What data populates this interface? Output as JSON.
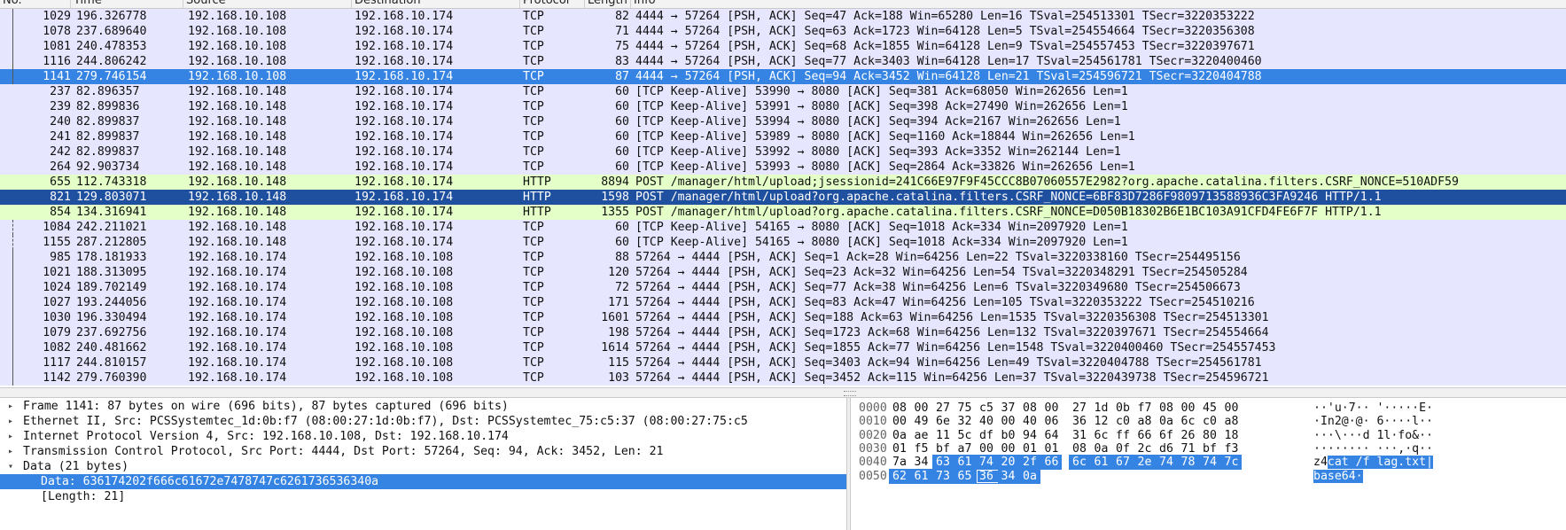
{
  "columns": [
    "No.",
    "Time",
    "Source",
    "Destination",
    "Protocol",
    "Length",
    "Info"
  ],
  "packets": [
    {
      "no": "1029",
      "time": "196.326778",
      "src": "192.168.10.108",
      "dst": "192.168.10.174",
      "proto": "TCP",
      "len": "82",
      "info": "4444 → 57264 [PSH, ACK] Seq=47 Ack=188 Win=65280 Len=16 TSval=254513301 TSecr=3220353222",
      "style": "tcp"
    },
    {
      "no": "1078",
      "time": "237.689640",
      "src": "192.168.10.108",
      "dst": "192.168.10.174",
      "proto": "TCP",
      "len": "71",
      "info": "4444 → 57264 [PSH, ACK] Seq=63 Ack=1723 Win=64128 Len=5 TSval=254554664 TSecr=3220356308",
      "style": "tcp"
    },
    {
      "no": "1081",
      "time": "240.478353",
      "src": "192.168.10.108",
      "dst": "192.168.10.174",
      "proto": "TCP",
      "len": "75",
      "info": "4444 → 57264 [PSH, ACK] Seq=68 Ack=1855 Win=64128 Len=9 TSval=254557453 TSecr=3220397671",
      "style": "tcp"
    },
    {
      "no": "1116",
      "time": "244.806242",
      "src": "192.168.10.108",
      "dst": "192.168.10.174",
      "proto": "TCP",
      "len": "83",
      "info": "4444 → 57264 [PSH, ACK] Seq=77 Ack=3403 Win=64128 Len=17 TSval=254561781 TSecr=3220400460",
      "style": "tcp"
    },
    {
      "no": "1141",
      "time": "279.746154",
      "src": "192.168.10.108",
      "dst": "192.168.10.174",
      "proto": "TCP",
      "len": "87",
      "info": "4444 → 57264 [PSH, ACK] Seq=94 Ack=3452 Win=64128 Len=21 TSval=254596721 TSecr=3220404788",
      "style": "sel"
    },
    {
      "no": "237",
      "time": "82.896357",
      "src": "192.168.10.148",
      "dst": "192.168.10.174",
      "proto": "TCP",
      "len": "60",
      "info": "[TCP Keep-Alive] 53990 → 8080 [ACK] Seq=381 Ack=68050 Win=262656 Len=1",
      "style": "tcp"
    },
    {
      "no": "239",
      "time": "82.899836",
      "src": "192.168.10.148",
      "dst": "192.168.10.174",
      "proto": "TCP",
      "len": "60",
      "info": "[TCP Keep-Alive] 53991 → 8080 [ACK] Seq=398 Ack=27490 Win=262656 Len=1",
      "style": "tcp"
    },
    {
      "no": "240",
      "time": "82.899837",
      "src": "192.168.10.148",
      "dst": "192.168.10.174",
      "proto": "TCP",
      "len": "60",
      "info": "[TCP Keep-Alive] 53994 → 8080 [ACK] Seq=394 Ack=2167 Win=262656 Len=1",
      "style": "tcp"
    },
    {
      "no": "241",
      "time": "82.899837",
      "src": "192.168.10.148",
      "dst": "192.168.10.174",
      "proto": "TCP",
      "len": "60",
      "info": "[TCP Keep-Alive] 53989 → 8080 [ACK] Seq=1160 Ack=18844 Win=262656 Len=1",
      "style": "tcp"
    },
    {
      "no": "242",
      "time": "82.899837",
      "src": "192.168.10.148",
      "dst": "192.168.10.174",
      "proto": "TCP",
      "len": "60",
      "info": "[TCP Keep-Alive] 53992 → 8080 [ACK] Seq=393 Ack=3352 Win=262144 Len=1",
      "style": "tcp"
    },
    {
      "no": "264",
      "time": "92.903734",
      "src": "192.168.10.148",
      "dst": "192.168.10.174",
      "proto": "TCP",
      "len": "60",
      "info": "[TCP Keep-Alive] 53993 → 8080 [ACK] Seq=2864 Ack=33826 Win=262656 Len=1",
      "style": "tcp"
    },
    {
      "no": "655",
      "time": "112.743318",
      "src": "192.168.10.148",
      "dst": "192.168.10.174",
      "proto": "HTTP",
      "len": "8894",
      "info": "POST /manager/html/upload;jsessionid=241C66E97F9F45CCC8B07060557E2982?org.apache.catalina.filters.CSRF_NONCE=510ADF59",
      "style": "http"
    },
    {
      "no": "821",
      "time": "129.803071",
      "src": "192.168.10.148",
      "dst": "192.168.10.174",
      "proto": "HTTP",
      "len": "1598",
      "info": "POST /manager/html/upload?org.apache.catalina.filters.CSRF_NONCE=6BF83D7286F9809713588936C3FA9246 HTTP/1.1",
      "style": "sel2"
    },
    {
      "no": "854",
      "time": "134.316941",
      "src": "192.168.10.148",
      "dst": "192.168.10.174",
      "proto": "HTTP",
      "len": "1355",
      "info": "POST /manager/html/upload?org.apache.catalina.filters.CSRF_NONCE=D050B18302B6E1BC103A91CFD4FE6F7F HTTP/1.1",
      "style": "http"
    },
    {
      "no": "1084",
      "time": "242.211021",
      "src": "192.168.10.148",
      "dst": "192.168.10.174",
      "proto": "TCP",
      "len": "60",
      "info": "[TCP Keep-Alive] 54165 → 8080 [ACK] Seq=1018 Ack=334 Win=2097920 Len=1",
      "style": "tcp"
    },
    {
      "no": "1155",
      "time": "287.212805",
      "src": "192.168.10.148",
      "dst": "192.168.10.174",
      "proto": "TCP",
      "len": "60",
      "info": "[TCP Keep-Alive] 54165 → 8080 [ACK] Seq=1018 Ack=334 Win=2097920 Len=1",
      "style": "tcp"
    },
    {
      "no": "985",
      "time": "178.181933",
      "src": "192.168.10.174",
      "dst": "192.168.10.108",
      "proto": "TCP",
      "len": "88",
      "info": "57264 → 4444 [PSH, ACK] Seq=1 Ack=28 Win=64256 Len=22 TSval=3220338160 TSecr=254495156",
      "style": "tcp"
    },
    {
      "no": "1021",
      "time": "188.313095",
      "src": "192.168.10.174",
      "dst": "192.168.10.108",
      "proto": "TCP",
      "len": "120",
      "info": "57264 → 4444 [PSH, ACK] Seq=23 Ack=32 Win=64256 Len=54 TSval=3220348291 TSecr=254505284",
      "style": "tcp"
    },
    {
      "no": "1024",
      "time": "189.702149",
      "src": "192.168.10.174",
      "dst": "192.168.10.108",
      "proto": "TCP",
      "len": "72",
      "info": "57264 → 4444 [PSH, ACK] Seq=77 Ack=38 Win=64256 Len=6 TSval=3220349680 TSecr=254506673",
      "style": "tcp"
    },
    {
      "no": "1027",
      "time": "193.244056",
      "src": "192.168.10.174",
      "dst": "192.168.10.108",
      "proto": "TCP",
      "len": "171",
      "info": "57264 → 4444 [PSH, ACK] Seq=83 Ack=47 Win=64256 Len=105 TSval=3220353222 TSecr=254510216",
      "style": "tcp"
    },
    {
      "no": "1030",
      "time": "196.330494",
      "src": "192.168.10.174",
      "dst": "192.168.10.108",
      "proto": "TCP",
      "len": "1601",
      "info": "57264 → 4444 [PSH, ACK] Seq=188 Ack=63 Win=64256 Len=1535 TSval=3220356308 TSecr=254513301",
      "style": "tcp"
    },
    {
      "no": "1079",
      "time": "237.692756",
      "src": "192.168.10.174",
      "dst": "192.168.10.108",
      "proto": "TCP",
      "len": "198",
      "info": "57264 → 4444 [PSH, ACK] Seq=1723 Ack=68 Win=64256 Len=132 TSval=3220397671 TSecr=254554664",
      "style": "tcp"
    },
    {
      "no": "1082",
      "time": "240.481662",
      "src": "192.168.10.174",
      "dst": "192.168.10.108",
      "proto": "TCP",
      "len": "1614",
      "info": "57264 → 4444 [PSH, ACK] Seq=1855 Ack=77 Win=64256 Len=1548 TSval=3220400460 TSecr=254557453",
      "style": "tcp"
    },
    {
      "no": "1117",
      "time": "244.810157",
      "src": "192.168.10.174",
      "dst": "192.168.10.108",
      "proto": "TCP",
      "len": "115",
      "info": "57264 → 4444 [PSH, ACK] Seq=3403 Ack=94 Win=64256 Len=49 TSval=3220404788 TSecr=254561781",
      "style": "tcp"
    },
    {
      "no": "1142",
      "time": "279.760390",
      "src": "192.168.10.174",
      "dst": "192.168.10.108",
      "proto": "TCP",
      "len": "103",
      "info": "57264 → 4444 [PSH, ACK] Seq=3452 Ack=115 Win=64256 Len=37 TSval=3220439738 TSecr=254596721",
      "style": "tcp"
    }
  ],
  "details": [
    {
      "text": "Frame 1141: 87 bytes on wire (696 bits), 87 bytes captured (696 bits)",
      "arrow": "▸"
    },
    {
      "text": "Ethernet II, Src: PCSSystemtec_1d:0b:f7 (08:00:27:1d:0b:f7), Dst: PCSSystemtec_75:c5:37 (08:00:27:75:c5",
      "arrow": "▸"
    },
    {
      "text": "Internet Protocol Version 4, Src: 192.168.10.108, Dst: 192.168.10.174",
      "arrow": "▸"
    },
    {
      "text": "Transmission Control Protocol, Src Port: 4444, Dst Port: 57264, Seq: 94, Ack: 3452, Len: 21",
      "arrow": "▸"
    },
    {
      "text": "Data (21 bytes)",
      "arrow": "▾"
    },
    {
      "text": "Data: 636174202f666c61672e7478747c6261736536340a",
      "arrow": "",
      "child": true,
      "selected": true
    },
    {
      "text": "[Length: 21]",
      "arrow": "",
      "child": true
    }
  ],
  "hex": [
    {
      "offset": "0000",
      "bytes": [
        "08",
        "00",
        "27",
        "75",
        "c5",
        "37",
        "08",
        "00",
        "27",
        "1d",
        "0b",
        "f7",
        "08",
        "00",
        "45",
        "00"
      ],
      "ascii": "··'u·7·· '·····E·",
      "hl_from": -1
    },
    {
      "offset": "0010",
      "bytes": [
        "00",
        "49",
        "6e",
        "32",
        "40",
        "00",
        "40",
        "06",
        "36",
        "12",
        "c0",
        "a8",
        "0a",
        "6c",
        "c0",
        "a8"
      ],
      "ascii": "·In2@·@· 6····l··",
      "hl_from": -1
    },
    {
      "offset": "0020",
      "bytes": [
        "0a",
        "ae",
        "11",
        "5c",
        "df",
        "b0",
        "94",
        "64",
        "31",
        "6c",
        "ff",
        "66",
        "6f",
        "26",
        "80",
        "18"
      ],
      "ascii": "···\\···d 1l·fo&··",
      "hl_from": -1
    },
    {
      "offset": "0030",
      "bytes": [
        "01",
        "f5",
        "bf",
        "a7",
        "00",
        "00",
        "01",
        "01",
        "08",
        "0a",
        "0f",
        "2c",
        "d6",
        "71",
        "bf",
        "f3"
      ],
      "ascii": "········ ···,·q··",
      "hl_from": -1
    },
    {
      "offset": "0040",
      "bytes": [
        "7a",
        "34",
        "63",
        "61",
        "74",
        "20",
        "2f",
        "66",
        "6c",
        "61",
        "67",
        "2e",
        "74",
        "78",
        "74",
        "7c"
      ],
      "ascii_plain": "z4",
      "ascii_hl": "cat /f lag.txt|",
      "hl_from": 2
    },
    {
      "offset": "0050",
      "bytes": [
        "62",
        "61",
        "73",
        "65",
        "36",
        "34",
        "0a"
      ],
      "ascii_hl": "base64·",
      "hl_from": 0,
      "boxed": 4
    }
  ]
}
